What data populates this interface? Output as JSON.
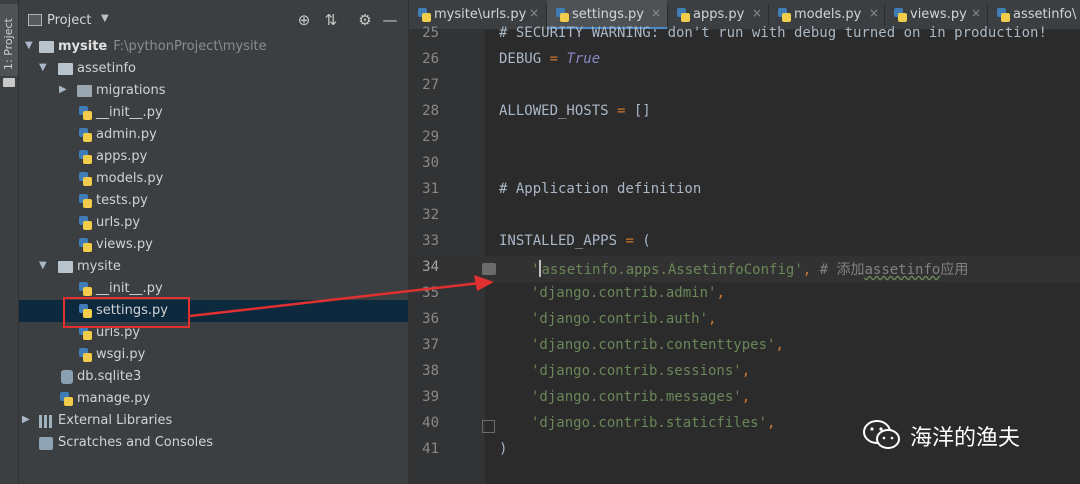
{
  "tool_strip": {
    "label": "1: Project"
  },
  "project_panel": {
    "title": "Project",
    "tree": [
      {
        "label": "mysite",
        "path": "F:\\pythonProject\\mysite"
      },
      {
        "label": "assetinfo"
      },
      {
        "label": "migrations"
      },
      {
        "label": "__init__.py"
      },
      {
        "label": "admin.py"
      },
      {
        "label": "apps.py"
      },
      {
        "label": "models.py"
      },
      {
        "label": "tests.py"
      },
      {
        "label": "urls.py"
      },
      {
        "label": "views.py"
      },
      {
        "label": "mysite"
      },
      {
        "label": "__init__.py"
      },
      {
        "label": "settings.py"
      },
      {
        "label": "urls.py"
      },
      {
        "label": "wsgi.py"
      },
      {
        "label": "db.sqlite3"
      },
      {
        "label": "manage.py"
      },
      {
        "label": "External Libraries"
      },
      {
        "label": "Scratches and Consoles"
      }
    ]
  },
  "editor": {
    "tabs": [
      {
        "label": "mysite\\urls.py"
      },
      {
        "label": "settings.py"
      },
      {
        "label": "apps.py"
      },
      {
        "label": "models.py"
      },
      {
        "label": "views.py"
      },
      {
        "label": "assetinfo\\"
      }
    ],
    "active_tab": "settings.py",
    "lines": [
      {
        "n": "25",
        "text": "# SECURITY WARNING: don't run with debug turned on in production!"
      },
      {
        "n": "26",
        "a": "DEBUG ",
        "b": "= ",
        "c": "True"
      },
      {
        "n": "27"
      },
      {
        "n": "28",
        "a": "ALLOWED_HOSTS ",
        "b": "= ",
        "c": "[]"
      },
      {
        "n": "29"
      },
      {
        "n": "30"
      },
      {
        "n": "31",
        "text": "# Application definition"
      },
      {
        "n": "32"
      },
      {
        "n": "33",
        "a": "INSTALLED_APPS ",
        "b": "= ",
        "c": "("
      },
      {
        "n": "34",
        "a": "'",
        "b": "assetinfo.apps.AssetinfoConfig",
        "c": "'",
        "d": ", ",
        "e": "# 添加",
        "f": "assetinfo",
        "g": "应用"
      },
      {
        "n": "35",
        "text": "'django.contrib.admin'"
      },
      {
        "n": "36",
        "text": "'django.contrib.auth'"
      },
      {
        "n": "37",
        "text": "'django.contrib.contenttypes'"
      },
      {
        "n": "38",
        "text": "'django.contrib.sessions'"
      },
      {
        "n": "39",
        "text": "'django.contrib.messages'"
      },
      {
        "n": "40",
        "text": "'django.contrib.staticfiles'"
      },
      {
        "n": "41",
        "text": ")"
      }
    ],
    "comma": ","
  },
  "watermark": {
    "text": "海洋的渔夫"
  },
  "colors": {
    "accent": "#4a88c7",
    "annotation_red": "#e03030"
  }
}
